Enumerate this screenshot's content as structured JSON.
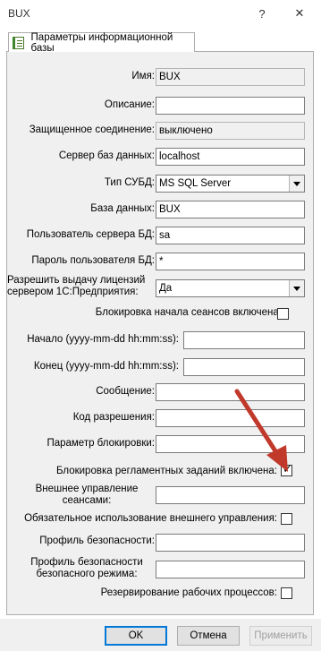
{
  "window": {
    "title": "BUX",
    "help_glyph": "?",
    "close_glyph": "✕"
  },
  "tab": {
    "label": "Параметры информационной базы"
  },
  "form": {
    "name_label": "Имя:",
    "name_value": "BUX",
    "description_label": "Описание:",
    "description_value": "",
    "secure_label": "Защищенное соединение:",
    "secure_value": "выключено",
    "dbserver_label": "Сервер баз данных:",
    "dbserver_value": "localhost",
    "dbms_label": "Тип СУБД:",
    "dbms_value": "MS SQL Server",
    "database_label": "База данных:",
    "database_value": "BUX",
    "dbuser_label": "Пользователь сервера БД:",
    "dbuser_value": "sa",
    "dbpass_label": "Пароль пользователя БД:",
    "dbpass_value": "*",
    "licenses_label_1": "Разрешить выдачу лицензий",
    "licenses_label_2": "сервером 1С:Предприятия:",
    "licenses_value": "Да",
    "sessions_block_label": "Блокировка начала сеансов включена:",
    "sessions_block_checked": false,
    "start_label": "Начало (yyyy-mm-dd hh:mm:ss):",
    "start_value": "",
    "end_label": "Конец (yyyy-mm-dd hh:mm:ss):",
    "end_value": "",
    "message_label": "Сообщение:",
    "message_value": "",
    "permission_label": "Код разрешения:",
    "permission_value": "",
    "block_param_label": "Параметр блокировки:",
    "block_param_value": "",
    "sched_block_label": "Блокировка регламентных заданий включена:",
    "sched_block_checked": true,
    "ext_mgmt_label_1": "Внешнее управление",
    "ext_mgmt_label_2": "сеансами:",
    "ext_mgmt_value": "",
    "mandatory_ext_label": "Обязательное использование внешнего управления:",
    "mandatory_ext_checked": false,
    "sec_profile_label": "Профиль безопасности:",
    "sec_profile_value": "",
    "safe_profile_label_1": "Профиль безопасности",
    "safe_profile_label_2": "безопасного режима:",
    "safe_profile_value": "",
    "reserve_label": "Резервирование рабочих процессов:",
    "reserve_checked": false,
    "checkmark": "✓"
  },
  "buttons": {
    "ok": "OK",
    "cancel": "Отмена",
    "apply": "Применить"
  },
  "colors": {
    "arrow": "#c0392b",
    "focus": "#0078d7"
  }
}
